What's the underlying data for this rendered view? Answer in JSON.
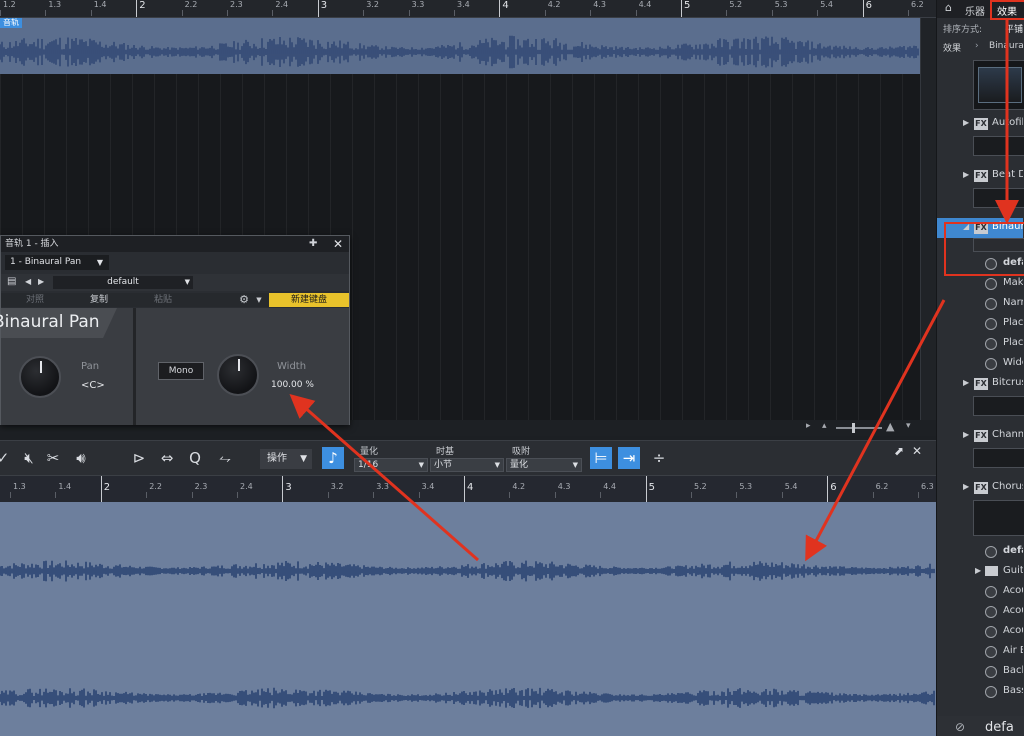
{
  "top_ruler": {
    "labels": [
      "1.2",
      "1.3",
      "1.4",
      "2",
      "2.2",
      "2.3",
      "2.4",
      "3",
      "3.2",
      "3.3",
      "3.4",
      "4",
      "4.2",
      "4.3",
      "4.4",
      "5",
      "5.2",
      "5.3",
      "5.4",
      "6",
      "6.2"
    ]
  },
  "track_tag": "音轨",
  "insert_window": {
    "title": "音轨 1 - 插入",
    "plugin_select": "1 - Binaural Pan",
    "preset_name": "default",
    "buttons": {
      "compare": "对照",
      "copy": "复制",
      "paste": "粘贴",
      "new_keyboard": "新建键盘"
    },
    "plugin_name": "Binaural Pan",
    "pan": {
      "label": "Pan",
      "value": "<C>"
    },
    "mono_button": "Mono",
    "width": {
      "label": "Width",
      "value": "100.00 %"
    }
  },
  "toolbar": {
    "action_label": "操作",
    "quantize_label": "量化",
    "quantize_value": "1/16",
    "timebase_label": "时基",
    "timebase_value": "小节",
    "snap_label": "吸附",
    "snap_value": "量化"
  },
  "editor_ruler": {
    "labels": [
      "1.3",
      "1.4",
      "2",
      "2.2",
      "2.3",
      "2.4",
      "3",
      "3.2",
      "3.3",
      "3.4",
      "4",
      "4.2",
      "4.3",
      "4.4",
      "5",
      "5.2",
      "5.3",
      "5.4",
      "6",
      "6.2",
      "6.3"
    ]
  },
  "browser": {
    "tabs": {
      "instruments": "乐器",
      "effects": "效果"
    },
    "sort_label": "排序方式:",
    "sort_value": "平铺",
    "breadcrumb_root": "效果",
    "breadcrumb_current": "Binaural",
    "items": [
      {
        "kind": "fx",
        "label": "Autofilter"
      },
      {
        "kind": "fx",
        "label": "Beat Delay"
      },
      {
        "kind": "fx",
        "label": "Binaural Pan",
        "selected": true
      },
      {
        "kind": "preset",
        "label": "default",
        "bold": true
      },
      {
        "kind": "preset",
        "label": "Make"
      },
      {
        "kind": "preset",
        "label": "Narrow"
      },
      {
        "kind": "preset",
        "label": "Place"
      },
      {
        "kind": "preset",
        "label": "Place"
      },
      {
        "kind": "preset",
        "label": "Wide"
      },
      {
        "kind": "fx",
        "label": "Bitcrusher"
      },
      {
        "kind": "fx",
        "label": "Channel"
      },
      {
        "kind": "fx",
        "label": "Chorus"
      },
      {
        "kind": "preset",
        "label": "default",
        "bold": true
      },
      {
        "kind": "folder",
        "label": "Guitar"
      },
      {
        "kind": "preset",
        "label": "Acoustic"
      },
      {
        "kind": "preset",
        "label": "Acoustic"
      },
      {
        "kind": "preset",
        "label": "Acoustic"
      },
      {
        "kind": "preset",
        "label": "Air B"
      },
      {
        "kind": "preset",
        "label": "Back"
      },
      {
        "kind": "preset",
        "label": "Bass"
      }
    ],
    "bottom_text": "defa"
  },
  "colors": {
    "accent_blue": "#3d8fe0",
    "annotation_red": "#e0331f",
    "wave_bg": "#6d7f9d",
    "wave_fg": "#1f3a6a"
  }
}
